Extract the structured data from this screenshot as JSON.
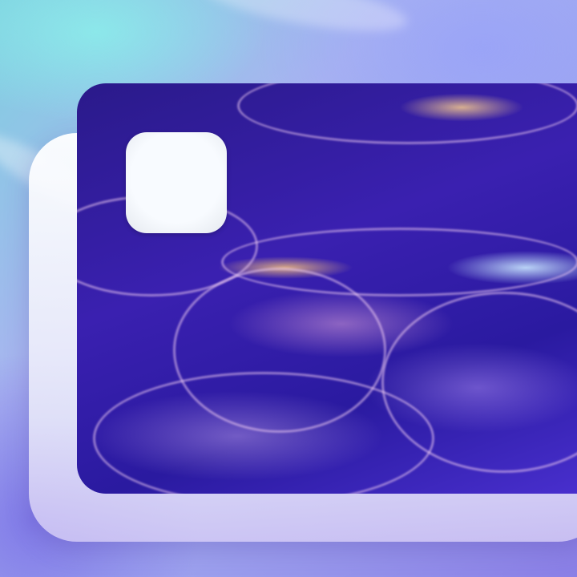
{
  "colors": {
    "background_start": "#7fd0e0",
    "background_end": "#8a7fe6",
    "photo_base": "#2a1a8a",
    "tile": "#f8fbff"
  }
}
